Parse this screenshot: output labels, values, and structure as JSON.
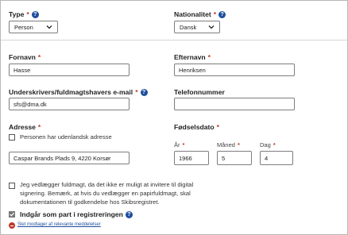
{
  "type": {
    "label": "Type",
    "value": "Person"
  },
  "nationality": {
    "label": "Nationalitet",
    "value": "Dansk"
  },
  "first_name": {
    "label": "Fornavn",
    "value": "Hasse"
  },
  "last_name": {
    "label": "Efternavn",
    "value": "Henriksen"
  },
  "email": {
    "label": "Underskrivers/fuldmagtshavers e-mail",
    "value": "sfs@dma.dk"
  },
  "phone": {
    "label": "Telefonnummer",
    "value": ""
  },
  "address": {
    "label": "Adresse",
    "foreign_checkbox_label": "Personen har udenlandsk adresse",
    "value": "Caspar Brands Plads 9, 4220 Korsør"
  },
  "birthdate": {
    "label": "Fødselsdato",
    "year_label": "År",
    "month_label": "Måned",
    "day_label": "Dag",
    "year": "1966",
    "month": "5",
    "day": "4"
  },
  "power_of_attorney": {
    "line1": "Jeg vedlægger fuldmagt, da det ikke er muligt at invitere til digital",
    "line2": "signering. Bemærk, at hvis du vedlægger en papirfuldmagt, skal",
    "line3": "dokumentationen til godkendelse hos Skibsregistret."
  },
  "registration_party": {
    "label": "Indgår som part i registreringen",
    "checked": true
  },
  "remove_link": "Slet modtager af relevante meddelelser",
  "colors": {
    "required": "#c0392b",
    "help": "#1f4e9e",
    "link": "#1f4e9e"
  }
}
